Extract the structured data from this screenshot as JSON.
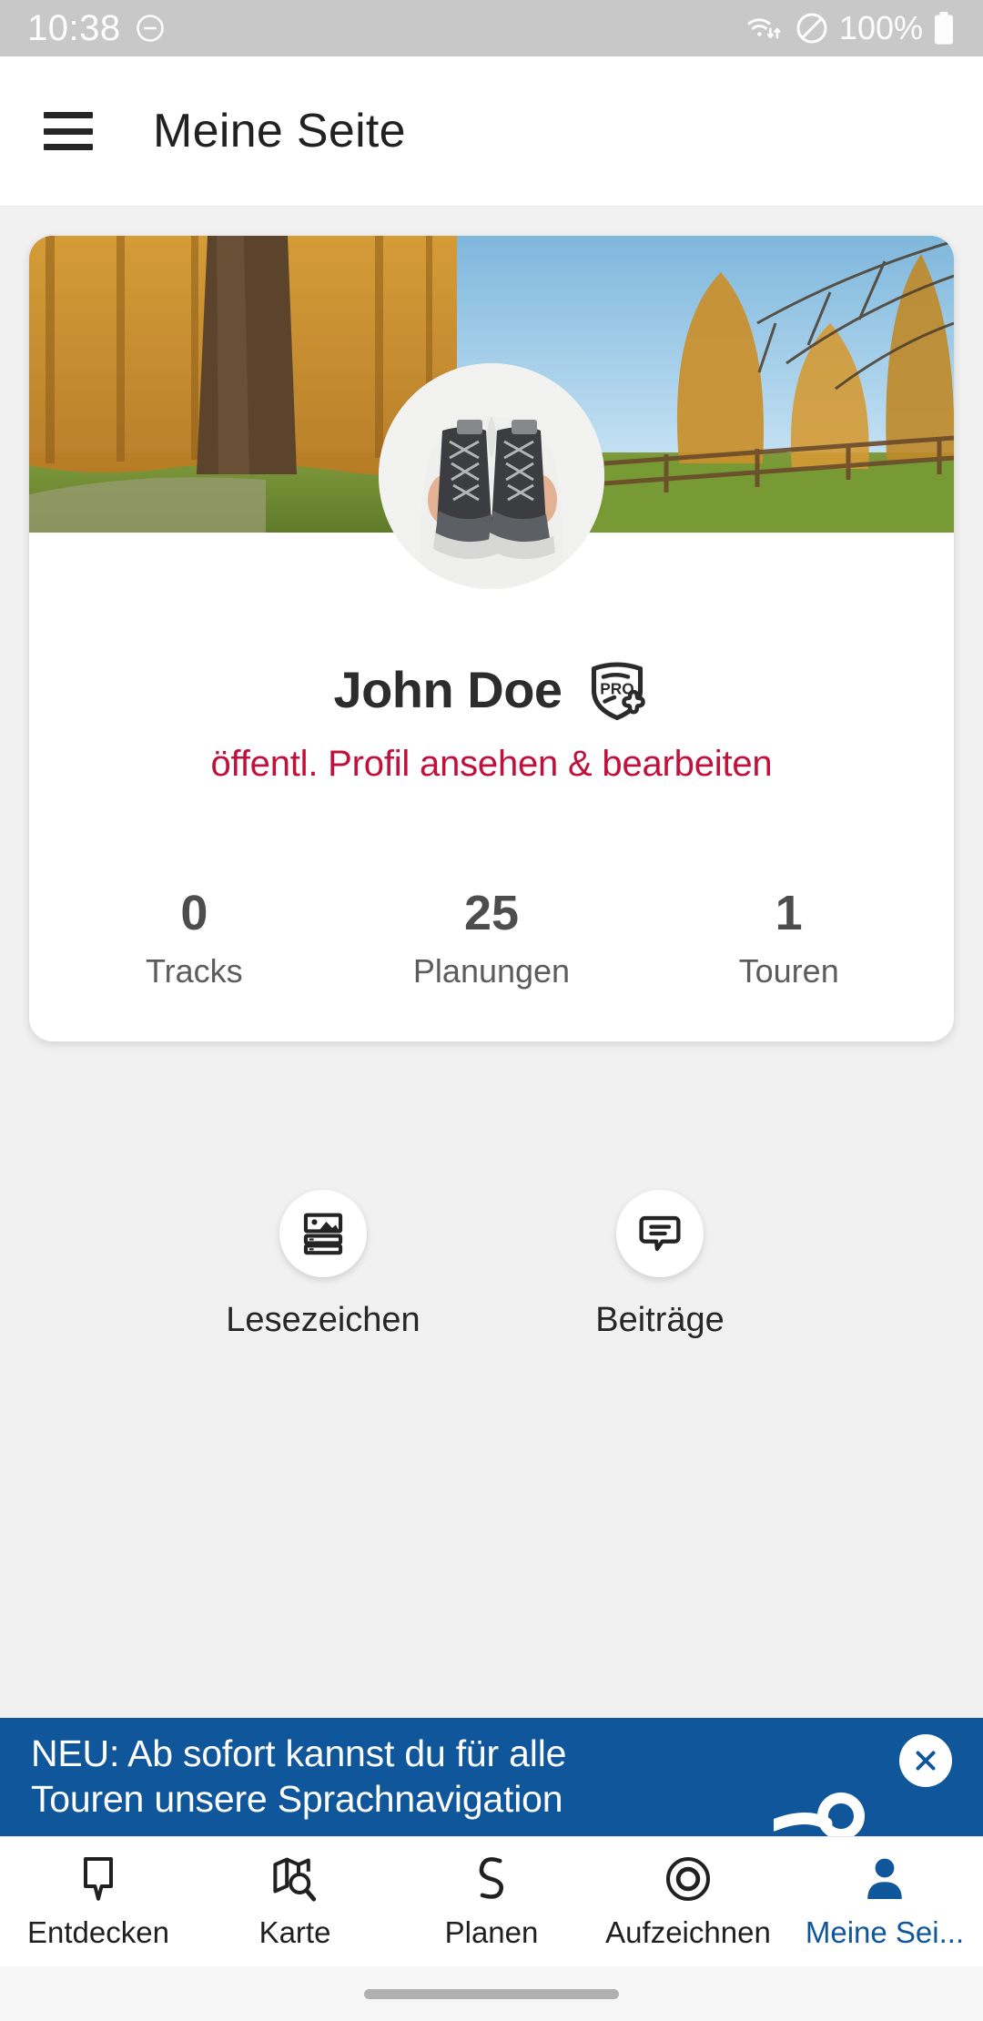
{
  "status_bar": {
    "time": "10:38",
    "dnd_icon": "do-not-disturb-icon",
    "wifi_icon": "wifi-icon",
    "blocked_icon": "no-signal-icon",
    "battery_percent": "100%",
    "battery_icon": "battery-full-icon",
    "background_color": "#c8c8c8"
  },
  "app_bar": {
    "menu_icon": "hamburger-menu-icon",
    "title": "Meine Seite"
  },
  "profile": {
    "cover_image_alt": "autumn larch forest with blue sky",
    "avatar_image_alt": "hands holding hiking boots",
    "name": "John Doe",
    "pro_badge_label": "PRO",
    "profile_link": "öffentl. Profil ansehen & bearbeiten",
    "link_color": "#c2103c",
    "stats": [
      {
        "value": "0",
        "label": "Tracks"
      },
      {
        "value": "25",
        "label": "Planungen"
      },
      {
        "value": "1",
        "label": "Touren"
      }
    ]
  },
  "quick_actions": [
    {
      "icon": "article-image-list-icon",
      "label": "Lesezeichen"
    },
    {
      "icon": "speech-bubble-icon",
      "label": "Beiträge"
    }
  ],
  "promo_banner": {
    "line1": "NEU: Ab sofort kannst du für alle",
    "line2": "Touren unsere Sprachnavigation",
    "close_icon": "close-icon",
    "art_icon": "voice-navigation-icon",
    "background_color": "#0f569b"
  },
  "bottom_nav": {
    "active_color": "#0f569b",
    "items": [
      {
        "icon": "map-pin-outline-icon",
        "label": "Entdecken",
        "active": false
      },
      {
        "icon": "map-search-icon",
        "label": "Karte",
        "active": false
      },
      {
        "icon": "route-squiggle-icon",
        "label": "Planen",
        "active": false
      },
      {
        "icon": "record-circle-icon",
        "label": "Aufzeichnen",
        "active": false
      },
      {
        "icon": "person-icon",
        "label": "Meine Sei...",
        "active": true
      }
    ]
  },
  "gesture_bar": {
    "handle": "home-indicator"
  }
}
